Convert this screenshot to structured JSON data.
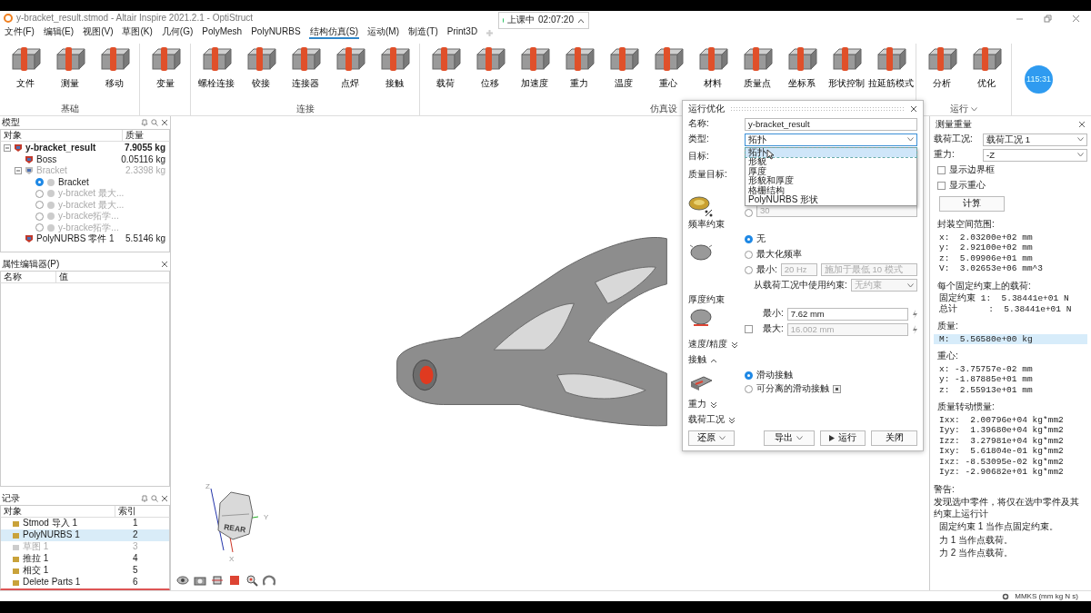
{
  "window": {
    "title": "y-bracket_result.stmod - Altair Inspire 2021.2.1 - OptiStruct"
  },
  "class_timer": {
    "label": "上课中",
    "time": "02:07:20"
  },
  "menu": [
    {
      "label": "文件(F)",
      "selected": false
    },
    {
      "label": "编辑(E)",
      "selected": false
    },
    {
      "label": "视图(V)",
      "selected": false
    },
    {
      "label": "草图(K)",
      "selected": false
    },
    {
      "label": "几何(G)",
      "selected": false
    },
    {
      "label": "PolyMesh",
      "selected": false
    },
    {
      "label": "PolyNURBS",
      "selected": false
    },
    {
      "label": "结构仿真(S)",
      "selected": true
    },
    {
      "label": "运动(M)",
      "selected": false
    },
    {
      "label": "制造(T)",
      "selected": false
    },
    {
      "label": "Print3D",
      "selected": false
    }
  ],
  "ribbon": [
    {
      "label": "基础",
      "tools": [
        "文件",
        "测量",
        "移动"
      ]
    },
    {
      "tools": [
        "变量"
      ]
    },
    {
      "label": "连接",
      "tools": [
        "螺栓连接",
        "铰接",
        "连接器",
        "点焊",
        "接触"
      ]
    },
    {
      "label": "仿真设",
      "tools": [
        "载荷",
        "位移",
        "加速度",
        "重力",
        "温度",
        "重心",
        "材料",
        "质量点",
        "坐标系",
        "形状控制",
        "拉延筋模式"
      ]
    },
    {
      "label": "运行",
      "has_menu": true,
      "tools": [
        "分析",
        "优化"
      ]
    }
  ],
  "countdown": "115:31",
  "model_panel": {
    "title": "模型",
    "columns": [
      "对象",
      "质量"
    ],
    "tree": [
      {
        "name": "y-bracket_result",
        "mass": "7.9055 kg",
        "kind": "part",
        "dimmed": false,
        "expanded": true,
        "children": [
          {
            "name": "Boss",
            "mass": "0.05116 kg",
            "kind": "part",
            "dimmed": false
          },
          {
            "name": "Bracket",
            "mass": "2.3398 kg",
            "kind": "part",
            "dimmed": true,
            "expanded": true,
            "children": [
              {
                "name": "Bracket",
                "kind": "variant",
                "dimmed": false,
                "selected": true
              },
              {
                "name": "y-bracket 最大...",
                "kind": "variant",
                "dimmed": true,
                "selected": false
              },
              {
                "name": "y-bracket 最大...",
                "kind": "variant",
                "dimmed": true,
                "selected": false
              },
              {
                "name": "y-bracke拓学...",
                "kind": "variant",
                "dimmed": true,
                "selected": false
              },
              {
                "name": "y-bracke拓学...",
                "kind": "variant",
                "dimmed": true,
                "selected": false
              }
            ]
          },
          {
            "name": "PolyNURBS 零件 1",
            "mass": "5.5146 kg",
            "kind": "part",
            "dimmed": false
          }
        ]
      }
    ]
  },
  "property_panel": {
    "title": "属性编辑器(P)",
    "columns": [
      "名称",
      "值"
    ]
  },
  "history_panel": {
    "title": "记录",
    "columns": [
      "对象",
      "索引"
    ],
    "rows": [
      {
        "name": "Stmod 导入 1",
        "index": "1",
        "selected": false,
        "dimmed": false
      },
      {
        "name": "PolyNURBS 1",
        "index": "2",
        "selected": true,
        "dimmed": false
      },
      {
        "name": "草图 1",
        "index": "3",
        "selected": false,
        "dimmed": true
      },
      {
        "name": "推拉 1",
        "index": "4",
        "selected": false,
        "dimmed": false
      },
      {
        "name": "相交 1",
        "index": "5",
        "selected": false,
        "dimmed": false
      },
      {
        "name": "Delete Parts 1",
        "index": "6",
        "selected": false,
        "dimmed": false
      }
    ]
  },
  "viewport": {
    "cube_face": "REAR",
    "axes": [
      "Z",
      "Y",
      "X"
    ]
  },
  "dialog": {
    "title": "运行优化",
    "name": {
      "label": "名称:",
      "value": "y-bracket_result"
    },
    "type": {
      "label": "类型:",
      "value": "拓扑",
      "expanded": true,
      "options": [
        {
          "label": "拓扑",
          "selected": true
        },
        {
          "label": "形貌",
          "selected": false
        },
        {
          "label": "厚度",
          "selected": false
        },
        {
          "label": "形貌和厚度",
          "selected": false
        },
        {
          "label": "格栅结构",
          "selected": false
        },
        {
          "label": "PolyNURBS 形状",
          "selected": false
        }
      ]
    },
    "target": {
      "label": "目标:"
    },
    "mass_target": {
      "label": "质量目标:",
      "value": "30",
      "selected": false,
      "disabled": true
    },
    "frequency": {
      "title": "频率约束",
      "options": [
        {
          "label": "无",
          "selected": true
        },
        {
          "label": "最大化频率",
          "selected": false
        },
        {
          "label": "最小:",
          "selected": false
        }
      ],
      "min_value": "20 Hz",
      "mode": "施加于最低 10 模式",
      "disabled": true,
      "load_case_label": "从载荷工况中使用约束:",
      "load_case_value": "无约束"
    },
    "thickness": {
      "title": "厚度约束",
      "min": {
        "label": "最小:",
        "value": "7.62 mm"
      },
      "max": {
        "label": "最大:",
        "value": "16.002 mm",
        "checked": false
      }
    },
    "speed": {
      "label": "速度/精度",
      "expanded": false
    },
    "contact": {
      "label": "接触",
      "expanded": true,
      "options": [
        {
          "label": "滑动接触",
          "selected": true
        },
        {
          "label": "可分离的滑动接触",
          "selected": false
        }
      ]
    },
    "gravity": {
      "label": "重力",
      "expanded": false
    },
    "load_cases": {
      "label": "载荷工况",
      "expanded": false
    },
    "buttons": [
      {
        "label": "还原",
        "kind": "menu"
      },
      {
        "label": "导出",
        "kind": "menu"
      },
      {
        "label": "运行",
        "kind": "run"
      },
      {
        "label": "关闭",
        "kind": "plain"
      }
    ]
  },
  "measure_panel": {
    "title": "测量重量",
    "load_case": {
      "label": "载荷工况:",
      "value": "载荷工况 1"
    },
    "gravity": {
      "label": "重力:",
      "value": "-Z"
    },
    "checks": [
      {
        "label": "显示边界框",
        "checked": false
      },
      {
        "label": "显示重心",
        "checked": false
      }
    ],
    "button": "计算",
    "sections": [
      {
        "title": "封装空间范围:",
        "highlighted": false,
        "lines": [
          "x:  2.03200e+02 mm",
          "y:  2.92100e+02 mm",
          "z:  5.09906e+01 mm",
          "V:  3.02653e+06 mm^3"
        ]
      },
      {
        "title": "每个固定约束上的载荷:",
        "highlighted": false,
        "lines": [
          "固定约束 1:  5.38441e+01 N",
          "总计      :  5.38441e+01 N"
        ]
      },
      {
        "title": "质量:",
        "highlighted": true,
        "lines": [
          "M:  5.56580e+00 kg"
        ]
      },
      {
        "title": "重心:",
        "highlighted": false,
        "lines": [
          "x: -3.75757e-02 mm",
          "y: -1.87885e+01 mm",
          "z:  2.55913e+01 mm"
        ]
      },
      {
        "title": "质量转动惯量:",
        "highlighted": false,
        "lines": [
          "Ixx:  2.00796e+04 kg*mm2",
          "Iyy:  1.39680e+04 kg*mm2",
          "Izz:  3.27981e+04 kg*mm2",
          "Ixy:  5.61804e-01 kg*mm2",
          "Ixz: -8.53095e-02 kg*mm2",
          "Iyz: -2.90682e+01 kg*mm2"
        ]
      }
    ],
    "warning": {
      "title": "警告:",
      "lines": [
        "发现选中零件，将仅在选中零件及其约束上运行计",
        "固定约束 1 当作点固定约束。",
        "力 1 当作点载荷。",
        "力 2 当作点载荷。"
      ]
    }
  },
  "status_bar": {
    "units": "MMKS (mm kg N s)"
  }
}
